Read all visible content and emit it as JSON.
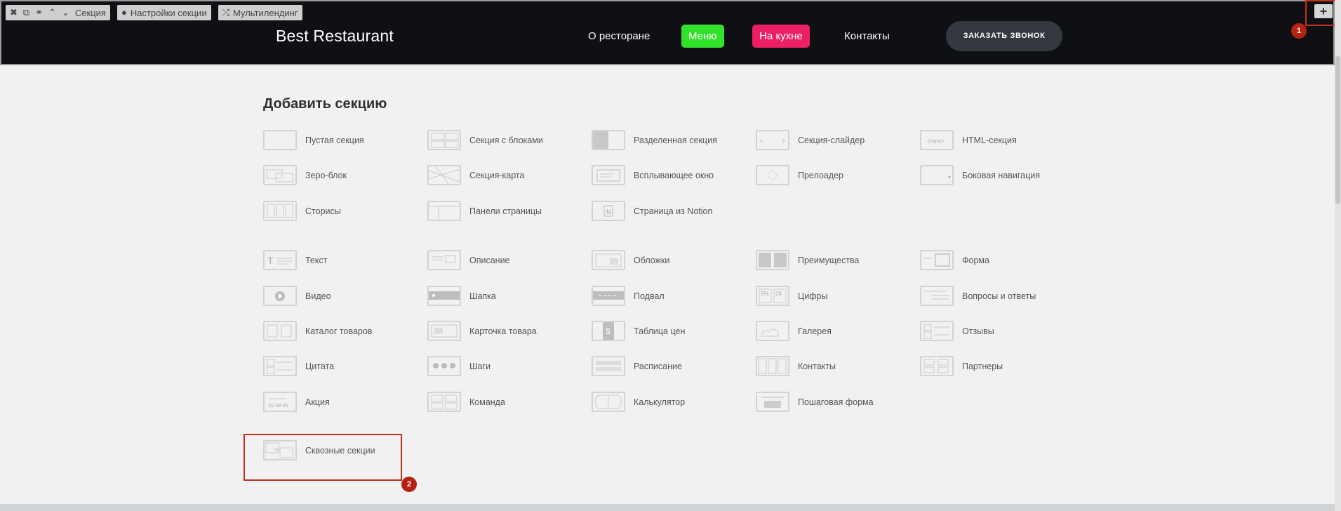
{
  "toolbar": {
    "section_label": "Секция",
    "settings_label": "Настройки секции",
    "multilanding_label": "Мультилендинг",
    "icons": [
      "close-icon",
      "copy-icon",
      "link-icon",
      "chevron-up-icon",
      "chevron-down-icon"
    ]
  },
  "site": {
    "brand": "Best Restaurant",
    "nav": [
      {
        "label": "О ресторане",
        "color": ""
      },
      {
        "label": "Меню",
        "color": "#32e12a"
      },
      {
        "label": "На кухне",
        "color": "#ec1f65"
      },
      {
        "label": "Контакты",
        "color": ""
      }
    ],
    "call_button": "ЗАКАЗАТЬ ЗВОНОК",
    "plus": "+"
  },
  "markers": [
    "1",
    "2"
  ],
  "panel": {
    "title": "Добавить секцию",
    "items": [
      "Пустая секция",
      "Секция с блоками",
      "Разделенная секция",
      "Секция-слайдер",
      "HTML-секция",
      "Зеро-блок",
      "Секция-карта",
      "Всплывающее окно",
      "Прелоадер",
      "Боковая навигация",
      "Сторисы",
      "Панели страницы",
      "Страница из Notion",
      "Текст",
      "Описание",
      "Обложки",
      "Преимущества",
      "Форма",
      "Видео",
      "Шапка",
      "Подвал",
      "Цифры",
      "Вопросы и ответы",
      "Каталог товаров",
      "Карточка товара",
      "Таблица цен",
      "Галерея",
      "Отзывы",
      "Цитата",
      "Шаги",
      "Расписание",
      "Контакты",
      "Партнеры",
      "Акция",
      "Команда",
      "Калькулятор",
      "Пошаговая форма",
      "Сквозные секции"
    ],
    "thumb_texts": {
      "html": "<html>",
      "digits_a": "5%",
      "digits_b": "28",
      "price": "$",
      "timer": "01:08:35"
    }
  },
  "colors": {
    "header_bg": "#0f1014",
    "accent_marker": "#c0321d",
    "call_button_bg": "#363840"
  }
}
